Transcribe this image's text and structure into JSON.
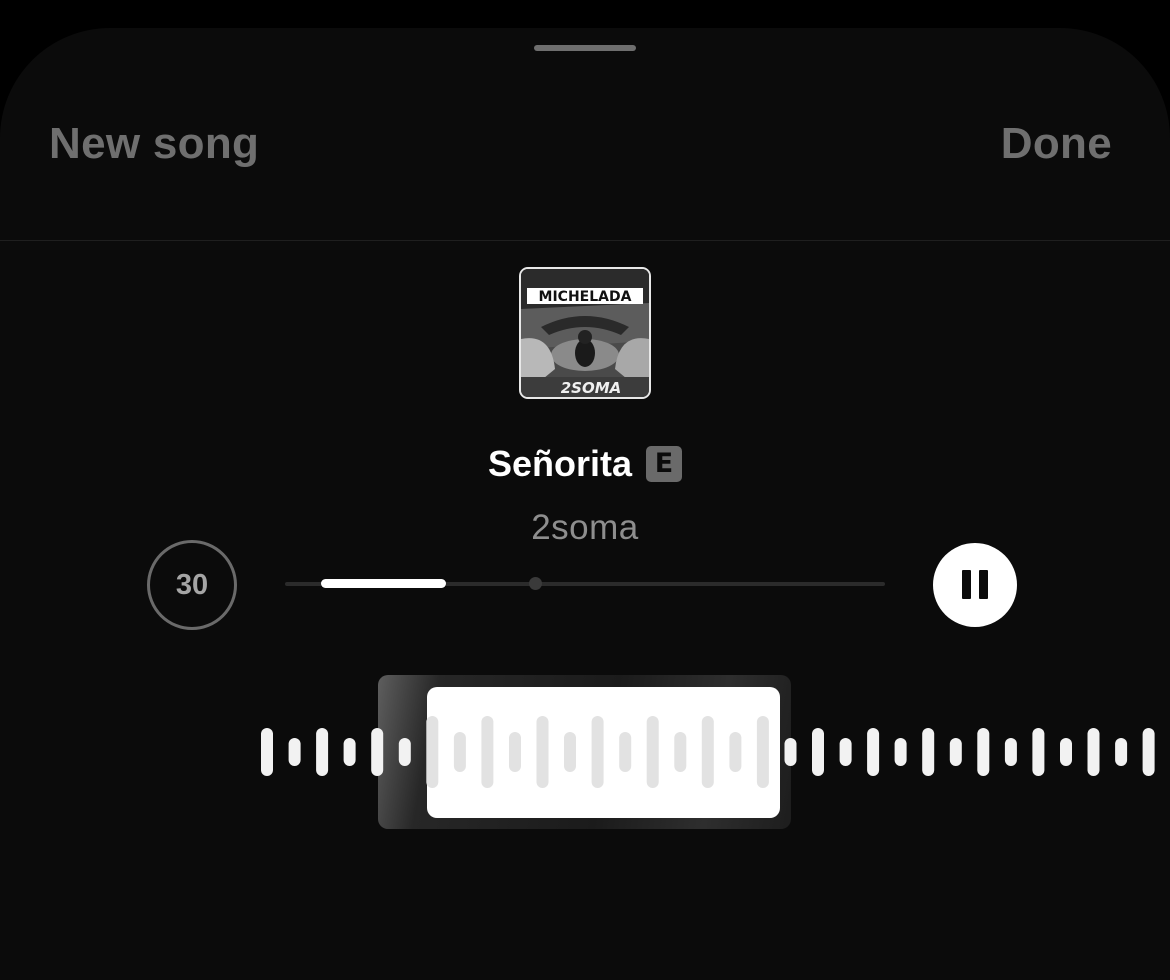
{
  "header": {
    "new_song_label": "New song",
    "done_label": "Done"
  },
  "track": {
    "title": "Señorita",
    "explicit_badge": "E",
    "artist": "2soma",
    "album_art_text": "MICHELADA",
    "album_art_bottom_text": "2SOMA"
  },
  "controls": {
    "clip_duration": "30",
    "play_state": "playing",
    "selection_start_fraction": 0.06,
    "selection_end_fraction": 0.27
  },
  "colors": {
    "background": "#0b0b0b",
    "text_primary": "#ffffff",
    "text_secondary": "#8e8e8e",
    "header_buttons": "#6f6f6f"
  }
}
